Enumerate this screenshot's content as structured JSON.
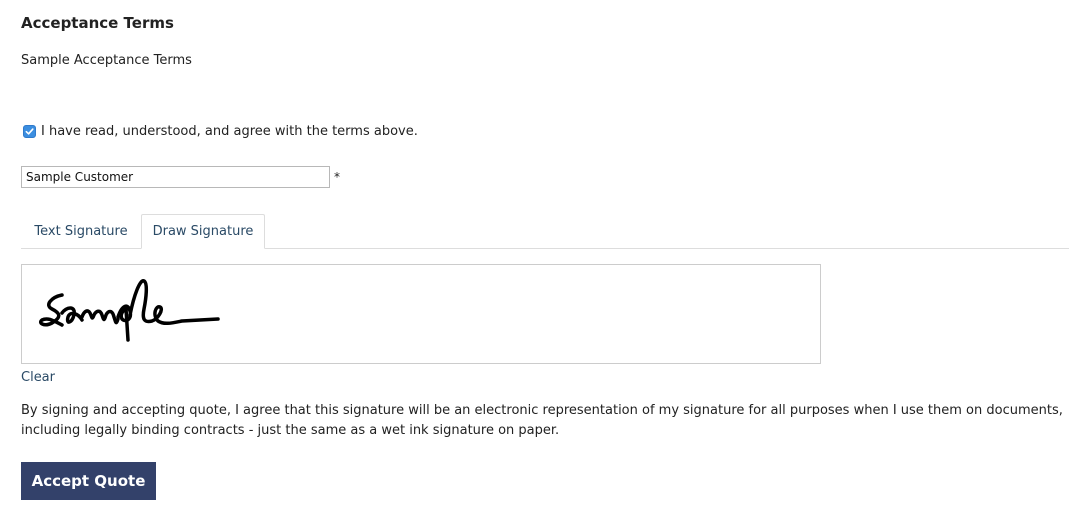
{
  "acceptance": {
    "title": "Acceptance Terms",
    "terms_text": "Sample Acceptance Terms",
    "agree_label": "I have read, understood, and agree with the terms above.",
    "agree_checked": true
  },
  "name_field": {
    "value": "Sample Customer",
    "required_marker": "*"
  },
  "tabs": [
    {
      "label": "Text Signature",
      "active": false
    },
    {
      "label": "Draw Signature",
      "active": true
    }
  ],
  "signature": {
    "clear_label": "Clear"
  },
  "disclaimer": "By signing and accepting quote, I agree that this signature will be an electronic representation of my signature for all purposes when I use them on documents, including legally binding contracts - just the same as a wet ink signature on paper.",
  "accept_button": {
    "label": "Accept Quote"
  },
  "colors": {
    "accent_button": "#33416a",
    "link": "#2a4a66",
    "checkbox": "#3b8ee0"
  }
}
